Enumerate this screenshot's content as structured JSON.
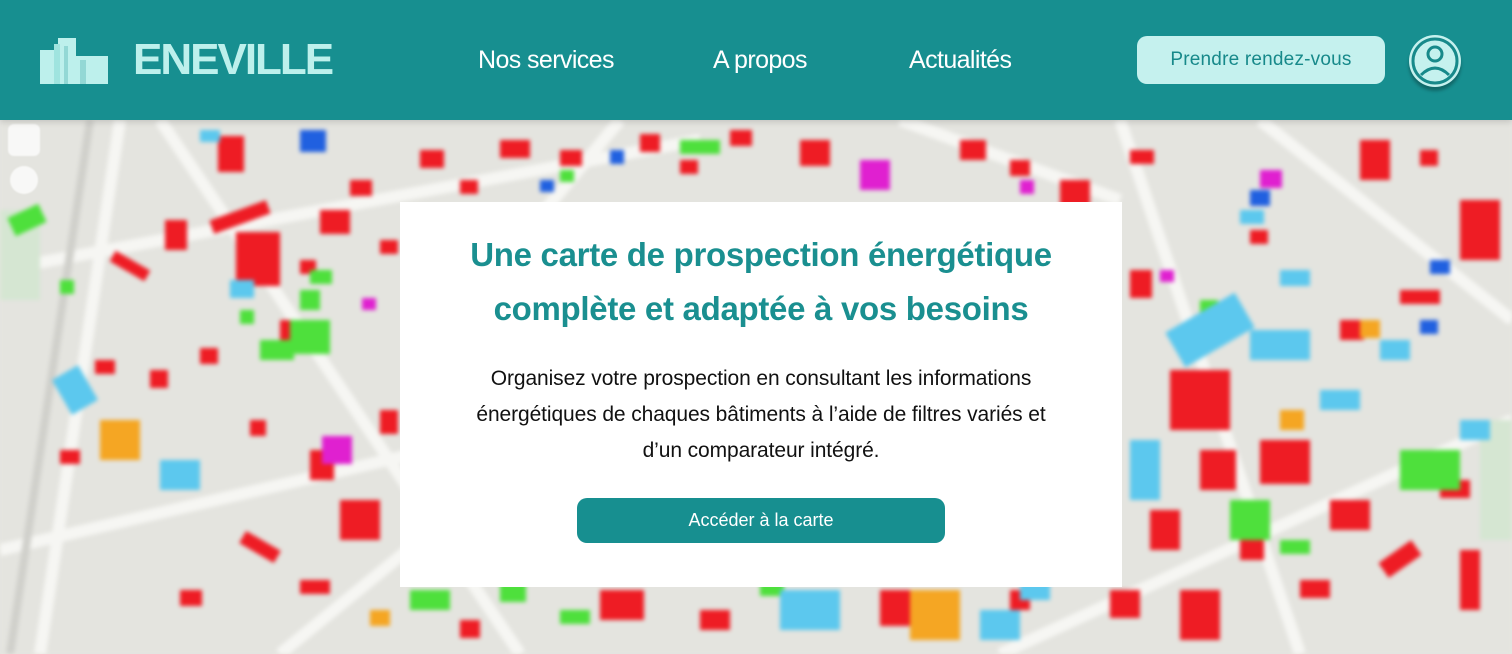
{
  "brand": {
    "logo_icon": "city-buildings-icon",
    "name": "ENEVILLE"
  },
  "nav": {
    "items": [
      {
        "label": "Nos services"
      },
      {
        "label": "A propos"
      },
      {
        "label": "Actualités"
      }
    ]
  },
  "header": {
    "appointment_label": "Prendre rendez-vous",
    "account_icon": "user-account-icon"
  },
  "hero": {
    "title_lines": [
      "Une carte de prospection énergétique",
      "complète et adaptée à vos besoins"
    ],
    "description_lines": [
      "Organisez votre prospection en consultant les informations",
      "énergétiques de chaques bâtiments à l’aide de filtres variés et",
      "d’un comparateur intégré."
    ],
    "cta_label": "Accéder à la carte"
  },
  "colors": {
    "header_bg": "#178f90",
    "accent_light": "#c5f1ee",
    "title_teal": "#1a8f90",
    "map_red": "#ee1c24",
    "map_green": "#4ee03c",
    "map_blue_light": "#5cc8ee",
    "map_orange": "#f5a623",
    "map_magenta": "#e020d0",
    "map_blue": "#2060e0"
  }
}
